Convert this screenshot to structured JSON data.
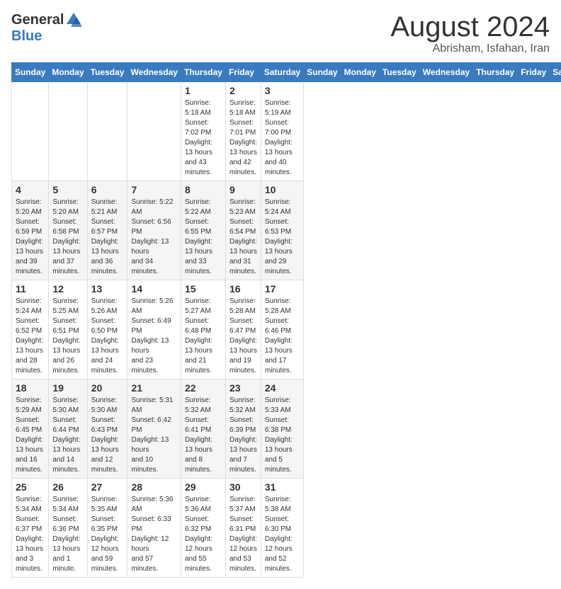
{
  "logo": {
    "general": "General",
    "blue": "Blue"
  },
  "header": {
    "month_title": "August 2024",
    "subtitle": "Abrisham, Isfahan, Iran"
  },
  "days_of_week": [
    "Sunday",
    "Monday",
    "Tuesday",
    "Wednesday",
    "Thursday",
    "Friday",
    "Saturday"
  ],
  "weeks": [
    [
      {
        "day": "",
        "info": ""
      },
      {
        "day": "",
        "info": ""
      },
      {
        "day": "",
        "info": ""
      },
      {
        "day": "",
        "info": ""
      },
      {
        "day": "1",
        "info": "Sunrise: 5:18 AM\nSunset: 7:02 PM\nDaylight: 13 hours\nand 43 minutes."
      },
      {
        "day": "2",
        "info": "Sunrise: 5:18 AM\nSunset: 7:01 PM\nDaylight: 13 hours\nand 42 minutes."
      },
      {
        "day": "3",
        "info": "Sunrise: 5:19 AM\nSunset: 7:00 PM\nDaylight: 13 hours\nand 40 minutes."
      }
    ],
    [
      {
        "day": "4",
        "info": "Sunrise: 5:20 AM\nSunset: 6:59 PM\nDaylight: 13 hours\nand 39 minutes."
      },
      {
        "day": "5",
        "info": "Sunrise: 5:20 AM\nSunset: 6:58 PM\nDaylight: 13 hours\nand 37 minutes."
      },
      {
        "day": "6",
        "info": "Sunrise: 5:21 AM\nSunset: 6:57 PM\nDaylight: 13 hours\nand 36 minutes."
      },
      {
        "day": "7",
        "info": "Sunrise: 5:22 AM\nSunset: 6:56 PM\nDaylight: 13 hours\nand 34 minutes."
      },
      {
        "day": "8",
        "info": "Sunrise: 5:22 AM\nSunset: 6:55 PM\nDaylight: 13 hours\nand 33 minutes."
      },
      {
        "day": "9",
        "info": "Sunrise: 5:23 AM\nSunset: 6:54 PM\nDaylight: 13 hours\nand 31 minutes."
      },
      {
        "day": "10",
        "info": "Sunrise: 5:24 AM\nSunset: 6:53 PM\nDaylight: 13 hours\nand 29 minutes."
      }
    ],
    [
      {
        "day": "11",
        "info": "Sunrise: 5:24 AM\nSunset: 6:52 PM\nDaylight: 13 hours\nand 28 minutes."
      },
      {
        "day": "12",
        "info": "Sunrise: 5:25 AM\nSunset: 6:51 PM\nDaylight: 13 hours\nand 26 minutes."
      },
      {
        "day": "13",
        "info": "Sunrise: 5:26 AM\nSunset: 6:50 PM\nDaylight: 13 hours\nand 24 minutes."
      },
      {
        "day": "14",
        "info": "Sunrise: 5:26 AM\nSunset: 6:49 PM\nDaylight: 13 hours\nand 23 minutes."
      },
      {
        "day": "15",
        "info": "Sunrise: 5:27 AM\nSunset: 6:48 PM\nDaylight: 13 hours\nand 21 minutes."
      },
      {
        "day": "16",
        "info": "Sunrise: 5:28 AM\nSunset: 6:47 PM\nDaylight: 13 hours\nand 19 minutes."
      },
      {
        "day": "17",
        "info": "Sunrise: 5:28 AM\nSunset: 6:46 PM\nDaylight: 13 hours\nand 17 minutes."
      }
    ],
    [
      {
        "day": "18",
        "info": "Sunrise: 5:29 AM\nSunset: 6:45 PM\nDaylight: 13 hours\nand 16 minutes."
      },
      {
        "day": "19",
        "info": "Sunrise: 5:30 AM\nSunset: 6:44 PM\nDaylight: 13 hours\nand 14 minutes."
      },
      {
        "day": "20",
        "info": "Sunrise: 5:30 AM\nSunset: 6:43 PM\nDaylight: 13 hours\nand 12 minutes."
      },
      {
        "day": "21",
        "info": "Sunrise: 5:31 AM\nSunset: 6:42 PM\nDaylight: 13 hours\nand 10 minutes."
      },
      {
        "day": "22",
        "info": "Sunrise: 5:32 AM\nSunset: 6:41 PM\nDaylight: 13 hours\nand 8 minutes."
      },
      {
        "day": "23",
        "info": "Sunrise: 5:32 AM\nSunset: 6:39 PM\nDaylight: 13 hours\nand 7 minutes."
      },
      {
        "day": "24",
        "info": "Sunrise: 5:33 AM\nSunset: 6:38 PM\nDaylight: 13 hours\nand 5 minutes."
      }
    ],
    [
      {
        "day": "25",
        "info": "Sunrise: 5:34 AM\nSunset: 6:37 PM\nDaylight: 13 hours\nand 3 minutes."
      },
      {
        "day": "26",
        "info": "Sunrise: 5:34 AM\nSunset: 6:36 PM\nDaylight: 13 hours\nand 1 minute."
      },
      {
        "day": "27",
        "info": "Sunrise: 5:35 AM\nSunset: 6:35 PM\nDaylight: 12 hours\nand 59 minutes."
      },
      {
        "day": "28",
        "info": "Sunrise: 5:36 AM\nSunset: 6:33 PM\nDaylight: 12 hours\nand 57 minutes."
      },
      {
        "day": "29",
        "info": "Sunrise: 5:36 AM\nSunset: 6:32 PM\nDaylight: 12 hours\nand 55 minutes."
      },
      {
        "day": "30",
        "info": "Sunrise: 5:37 AM\nSunset: 6:31 PM\nDaylight: 12 hours\nand 53 minutes."
      },
      {
        "day": "31",
        "info": "Sunrise: 5:38 AM\nSunset: 6:30 PM\nDaylight: 12 hours\nand 52 minutes."
      }
    ]
  ]
}
